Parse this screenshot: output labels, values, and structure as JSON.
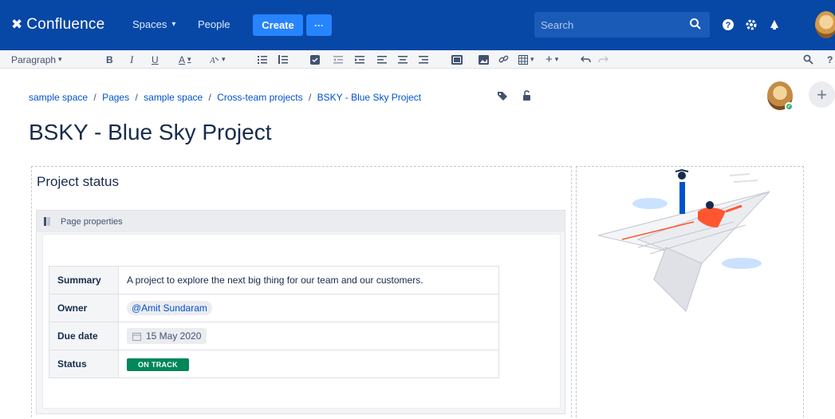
{
  "topnav": {
    "app_name": "Confluence",
    "spaces_label": "Spaces",
    "people_label": "People",
    "create_label": "Create",
    "more_label": "···",
    "search_placeholder": "Search",
    "icons": [
      "search-icon",
      "help-icon",
      "settings-icon",
      "notifications-icon",
      "user-avatar"
    ],
    "colors": {
      "bar": "#0747a6",
      "create": "#2684ff"
    }
  },
  "toolbar": {
    "style_label": "Paragraph",
    "bold": "B",
    "italic": "I",
    "underline": "U",
    "text_color": "A",
    "icons": [
      "bold-icon",
      "italic-icon",
      "underline-icon",
      "text-color-icon",
      "clear-formatting-icon",
      "bullet-list-icon",
      "numbered-list-icon",
      "task-list-icon",
      "outdent-icon",
      "indent-icon",
      "align-left-icon",
      "align-center-icon",
      "align-right-icon",
      "page-layout-icon",
      "image-icon",
      "link-icon",
      "table-icon",
      "insert-icon",
      "undo-icon",
      "redo-icon",
      "find-icon",
      "help-icon"
    ]
  },
  "breadcrumb": {
    "items": [
      "sample space",
      "Pages",
      "sample space",
      "Cross-team projects",
      "BSKY - Blue Sky Project"
    ],
    "separator": "/"
  },
  "page": {
    "title": "BSKY - Blue Sky Project",
    "section_heading": "Project status",
    "macro_title": "Page properties"
  },
  "properties": {
    "rows": [
      {
        "key": "Summary",
        "value": "A project to explore the next big thing for our team and our customers."
      },
      {
        "key": "Owner",
        "value": "@Amit Sundaram"
      },
      {
        "key": "Due date",
        "value": "15 May 2020"
      },
      {
        "key": "Status",
        "value": "ON TRACK"
      }
    ],
    "status_color": "#00875a"
  }
}
